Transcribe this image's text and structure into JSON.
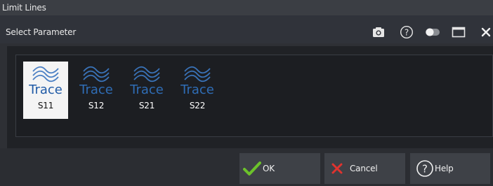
{
  "window": {
    "title": "Limit Lines"
  },
  "dialog": {
    "title": "Select Parameter",
    "icons": [
      "camera-icon",
      "help-circle-icon",
      "toggle-icon",
      "maximize-icon",
      "close-icon"
    ]
  },
  "parameters": [
    {
      "label": "S11",
      "trace_text": "Trace",
      "selected": true
    },
    {
      "label": "S12",
      "trace_text": "Trace",
      "selected": false
    },
    {
      "label": "S21",
      "trace_text": "Trace",
      "selected": false
    },
    {
      "label": "S22",
      "trace_text": "Trace",
      "selected": false
    }
  ],
  "buttons": {
    "ok": "OK",
    "cancel": "Cancel",
    "help": "Help"
  },
  "colors": {
    "accent_blue": "#2f6db6",
    "ok_green": "#6cc22b",
    "cancel_red": "#e0332f"
  }
}
